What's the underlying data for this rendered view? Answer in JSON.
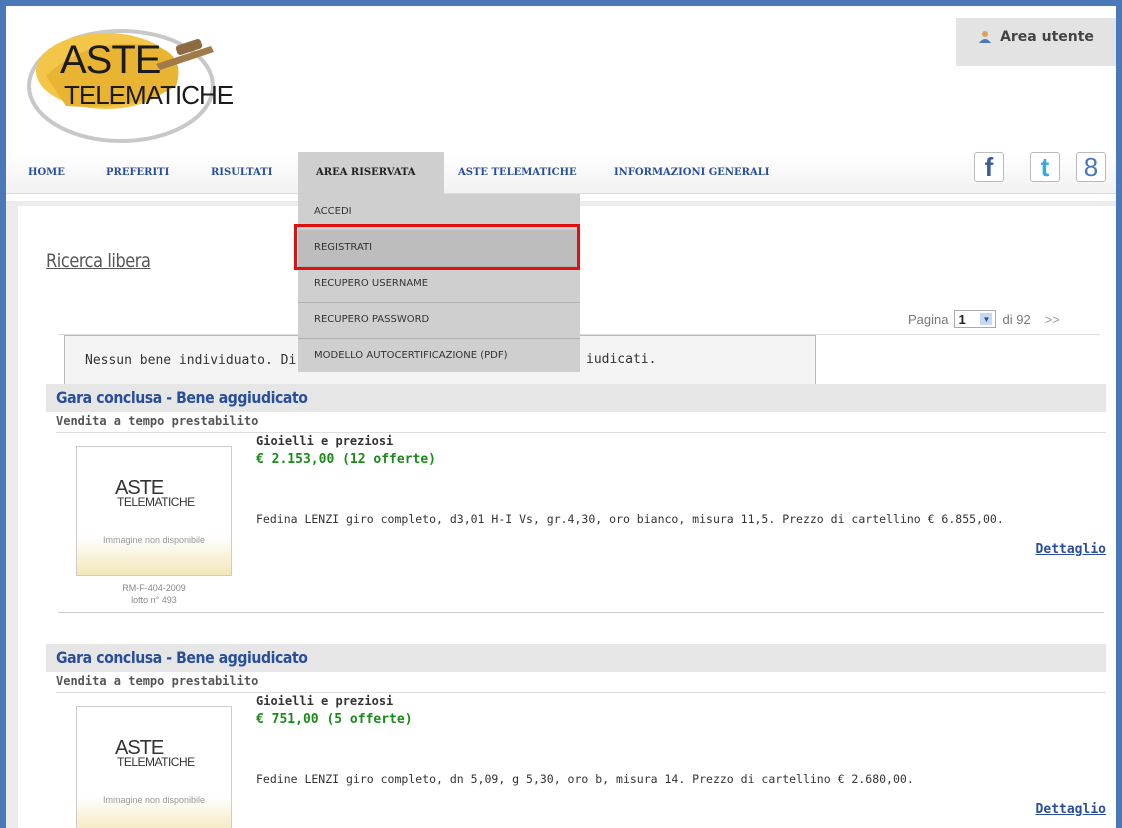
{
  "header": {
    "logo_line1": "ASTE",
    "logo_line2": "TELEMATICHE",
    "user_area_label": "Area utente"
  },
  "nav": {
    "items": [
      {
        "label": "HOME"
      },
      {
        "label": "PREFERITI"
      },
      {
        "label": "RISULTATI"
      },
      {
        "label": "AREA RISERVATA"
      },
      {
        "label": "ASTE TELEMATICHE"
      },
      {
        "label": "INFORMAZIONI GENERALI"
      }
    ],
    "social": {
      "facebook": "f",
      "twitter": "t",
      "google": "8"
    }
  },
  "dropdown": {
    "items": [
      {
        "label": "ACCEDI"
      },
      {
        "label": "REGISTRATI"
      },
      {
        "label": "RECUPERO USERNAME"
      },
      {
        "label": "RECUPERO PASSWORD"
      },
      {
        "label": "MODELLO AUTOCERTIFICAZIONE (PDF)"
      }
    ],
    "highlighted": "REGISTRATI"
  },
  "main": {
    "title": "Ricerca libera",
    "pagination": {
      "prefix": "Pagina",
      "current": "1",
      "total_label": "di 92",
      "next": ">>"
    },
    "notice_start": "Nessun bene individuato. Di s",
    "notice_end": "iudicati.",
    "lots": [
      {
        "status": "Gara conclusa - Bene aggiudicato",
        "sale_type": "Vendita a tempo prestabilito",
        "image_logo1": "ASTE",
        "image_logo2": "TELEMATICHE",
        "image_note": "Immagine non disponibile",
        "ref": "RM-F-404-2009",
        "lotto": "lotto n° 493",
        "category": "Gioielli e preziosi",
        "price": "€ 2.153,00 (12 offerte)",
        "description": "Fedina LENZI giro completo, d3,01 H-I Vs, gr.4,30, oro bianco, misura 11,5. Prezzo di cartellino € 6.855,00.",
        "detail_label": "Dettaglio"
      },
      {
        "status": "Gara conclusa - Bene aggiudicato",
        "sale_type": "Vendita a tempo prestabilito",
        "image_logo1": "ASTE",
        "image_logo2": "TELEMATICHE",
        "image_note": "Immagine non disponibile",
        "category": "Gioielli e preziosi",
        "price": "€ 751,00 (5 offerte)",
        "description": "Fedine LENZI giro completo, dn 5,09, g 5,30, oro b, misura 14. Prezzo di cartellino € 2.680,00.",
        "detail_label": "Dettaglio"
      }
    ]
  },
  "colors": {
    "frame_blue": "#4a78b8",
    "link_blue": "#2a4f9a",
    "price_green": "#1a8a1a",
    "highlight_red": "#e01010"
  }
}
